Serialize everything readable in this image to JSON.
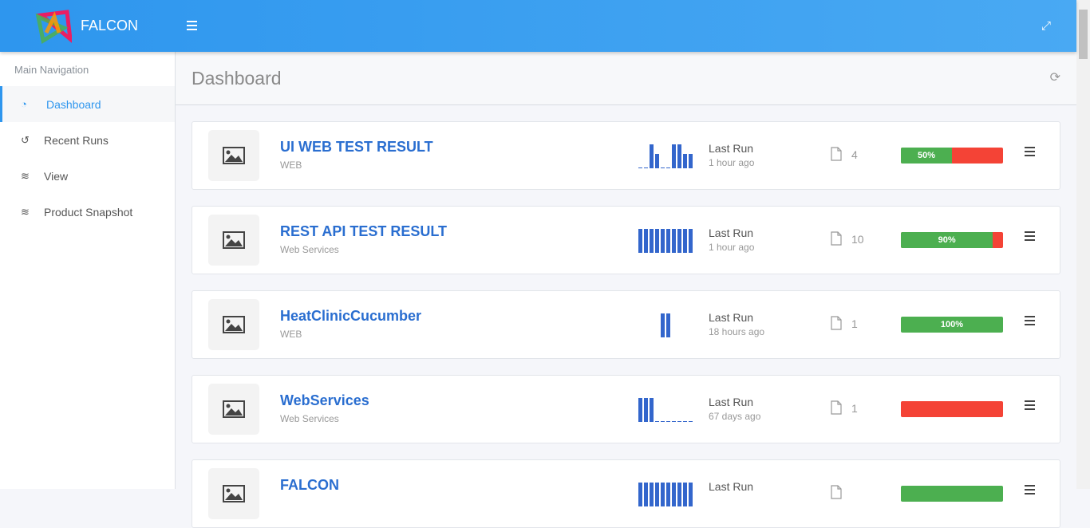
{
  "app": {
    "brand": "FALCON"
  },
  "sidebar": {
    "heading": "Main Navigation",
    "items": [
      {
        "label": "Dashboard",
        "icon": "gauge-icon",
        "active": true
      },
      {
        "label": "Recent Runs",
        "icon": "history-icon"
      },
      {
        "label": "View",
        "icon": "layers-icon"
      },
      {
        "label": "Product Snapshot",
        "icon": "layers-icon"
      }
    ]
  },
  "page": {
    "title": "Dashboard"
  },
  "colors": {
    "accent": "#2e96ee",
    "pass": "#4caf50",
    "fail": "#f44336",
    "link": "#2a6ed0"
  },
  "cards": [
    {
      "name": "UI WEB TEST RESULT",
      "type": "WEB",
      "last_run_label": "Last Run",
      "last_run": "1 hour ago",
      "count": "4",
      "pass_pct": 50,
      "pass_label": "50%",
      "history": [
        0,
        0,
        1,
        0.6,
        0,
        0,
        1,
        1,
        0.6,
        0.6
      ]
    },
    {
      "name": "REST API TEST RESULT",
      "type": "Web Services",
      "last_run_label": "Last Run",
      "last_run": "1 hour ago",
      "count": "10",
      "pass_pct": 90,
      "pass_label": "90%",
      "history": [
        1,
        1,
        1,
        1,
        1,
        1,
        1,
        1,
        1,
        1
      ]
    },
    {
      "name": "HeatClinicCucumber",
      "type": "WEB",
      "last_run_label": "Last Run",
      "last_run": "18 hours ago",
      "count": "1",
      "pass_pct": 100,
      "pass_label": "100%",
      "history": [
        1,
        1
      ]
    },
    {
      "name": "WebServices",
      "type": "Web Services",
      "last_run_label": "Last Run",
      "last_run": "67 days ago",
      "count": "1",
      "pass_pct": 0,
      "pass_label": "",
      "history": [
        1,
        1,
        1,
        0,
        0,
        0,
        0,
        0,
        0,
        0
      ]
    },
    {
      "name": "FALCON",
      "type": "",
      "last_run_label": "Last Run",
      "last_run": "",
      "count": "",
      "pass_pct": 100,
      "pass_label": "",
      "history": [
        1,
        1,
        1,
        1,
        1,
        1,
        1,
        1,
        1,
        1
      ]
    }
  ]
}
